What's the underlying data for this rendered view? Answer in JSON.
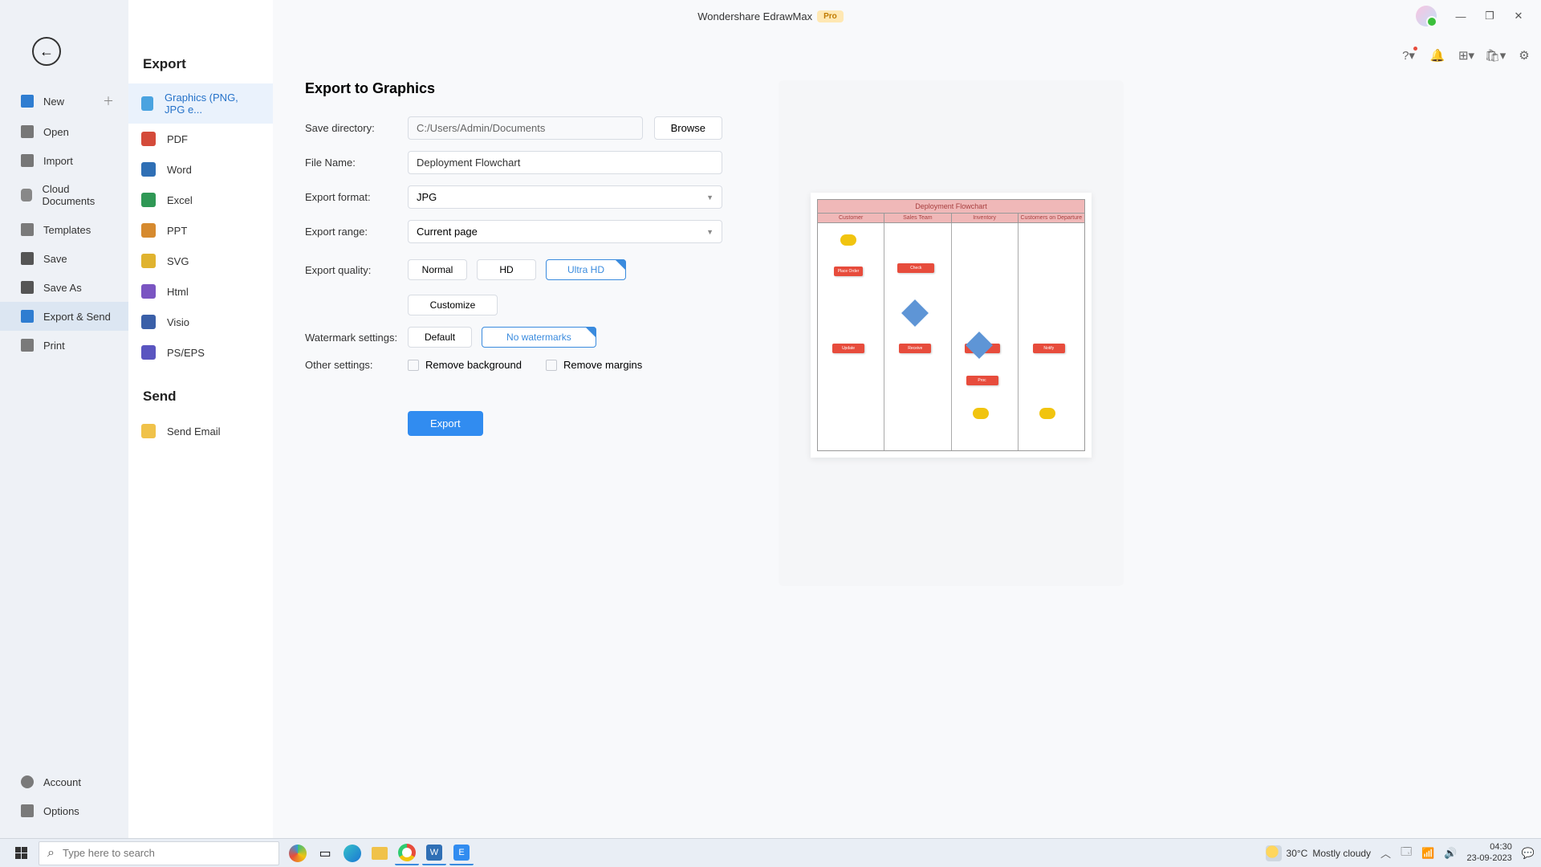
{
  "titlebar": {
    "app_name": "Wondershare EdrawMax",
    "badge": "Pro"
  },
  "window_controls": {
    "min": "—",
    "max": "❐",
    "close": "✕"
  },
  "top_icons": {
    "help": "?",
    "bell": "🔔",
    "grid": "⊞",
    "bag": "🛍",
    "gear": "⚙"
  },
  "nav": {
    "back": "←",
    "items": [
      {
        "label": "New",
        "has_plus": true
      },
      {
        "label": "Open"
      },
      {
        "label": "Import"
      },
      {
        "label": "Cloud Documents"
      },
      {
        "label": "Templates"
      },
      {
        "label": "Save"
      },
      {
        "label": "Save As"
      },
      {
        "label": "Export & Send",
        "active": true
      },
      {
        "label": "Print"
      }
    ],
    "bottom": [
      {
        "label": "Account"
      },
      {
        "label": "Options"
      }
    ]
  },
  "export_col": {
    "heading_export": "Export",
    "formats": [
      {
        "label": "Graphics (PNG, JPG e...",
        "color": "#4aa3e0",
        "selected": true
      },
      {
        "label": "PDF",
        "color": "#d44b3a"
      },
      {
        "label": "Word",
        "color": "#2f6fb5"
      },
      {
        "label": "Excel",
        "color": "#2f9855"
      },
      {
        "label": "PPT",
        "color": "#d68a2f"
      },
      {
        "label": "SVG",
        "color": "#e0b32f"
      },
      {
        "label": "Html",
        "color": "#7a55c2"
      },
      {
        "label": "Visio",
        "color": "#3a5fa8"
      },
      {
        "label": "PS/EPS",
        "color": "#5a55c0"
      }
    ],
    "heading_send": "Send",
    "send_items": [
      {
        "label": "Send Email",
        "color": "#f0c24a"
      }
    ]
  },
  "form": {
    "title": "Export to Graphics",
    "save_dir_label": "Save directory:",
    "save_dir_value": "C:/Users/Admin/Documents",
    "browse": "Browse",
    "file_name_label": "File Name:",
    "file_name_value": "Deployment Flowchart",
    "format_label": "Export format:",
    "format_value": "JPG",
    "range_label": "Export range:",
    "range_value": "Current page",
    "quality_label": "Export quality:",
    "quality_opts": {
      "normal": "Normal",
      "hd": "HD",
      "ultra": "Ultra HD"
    },
    "customize": "Customize",
    "watermark_label": "Watermark settings:",
    "watermark_opts": {
      "default": "Default",
      "none": "No watermarks"
    },
    "other_label": "Other settings:",
    "remove_bg": "Remove background",
    "remove_margins": "Remove margins",
    "export_btn": "Export"
  },
  "preview": {
    "title": "Deployment Flowchart",
    "lanes": [
      "Customer",
      "Sales Team",
      "Inventory",
      "Customers on Departure"
    ]
  },
  "taskbar": {
    "search_placeholder": "Type here to search",
    "weather_temp": "30°C",
    "weather_desc": "Mostly cloudy",
    "time": "04:30",
    "date": "23-09-2023"
  }
}
